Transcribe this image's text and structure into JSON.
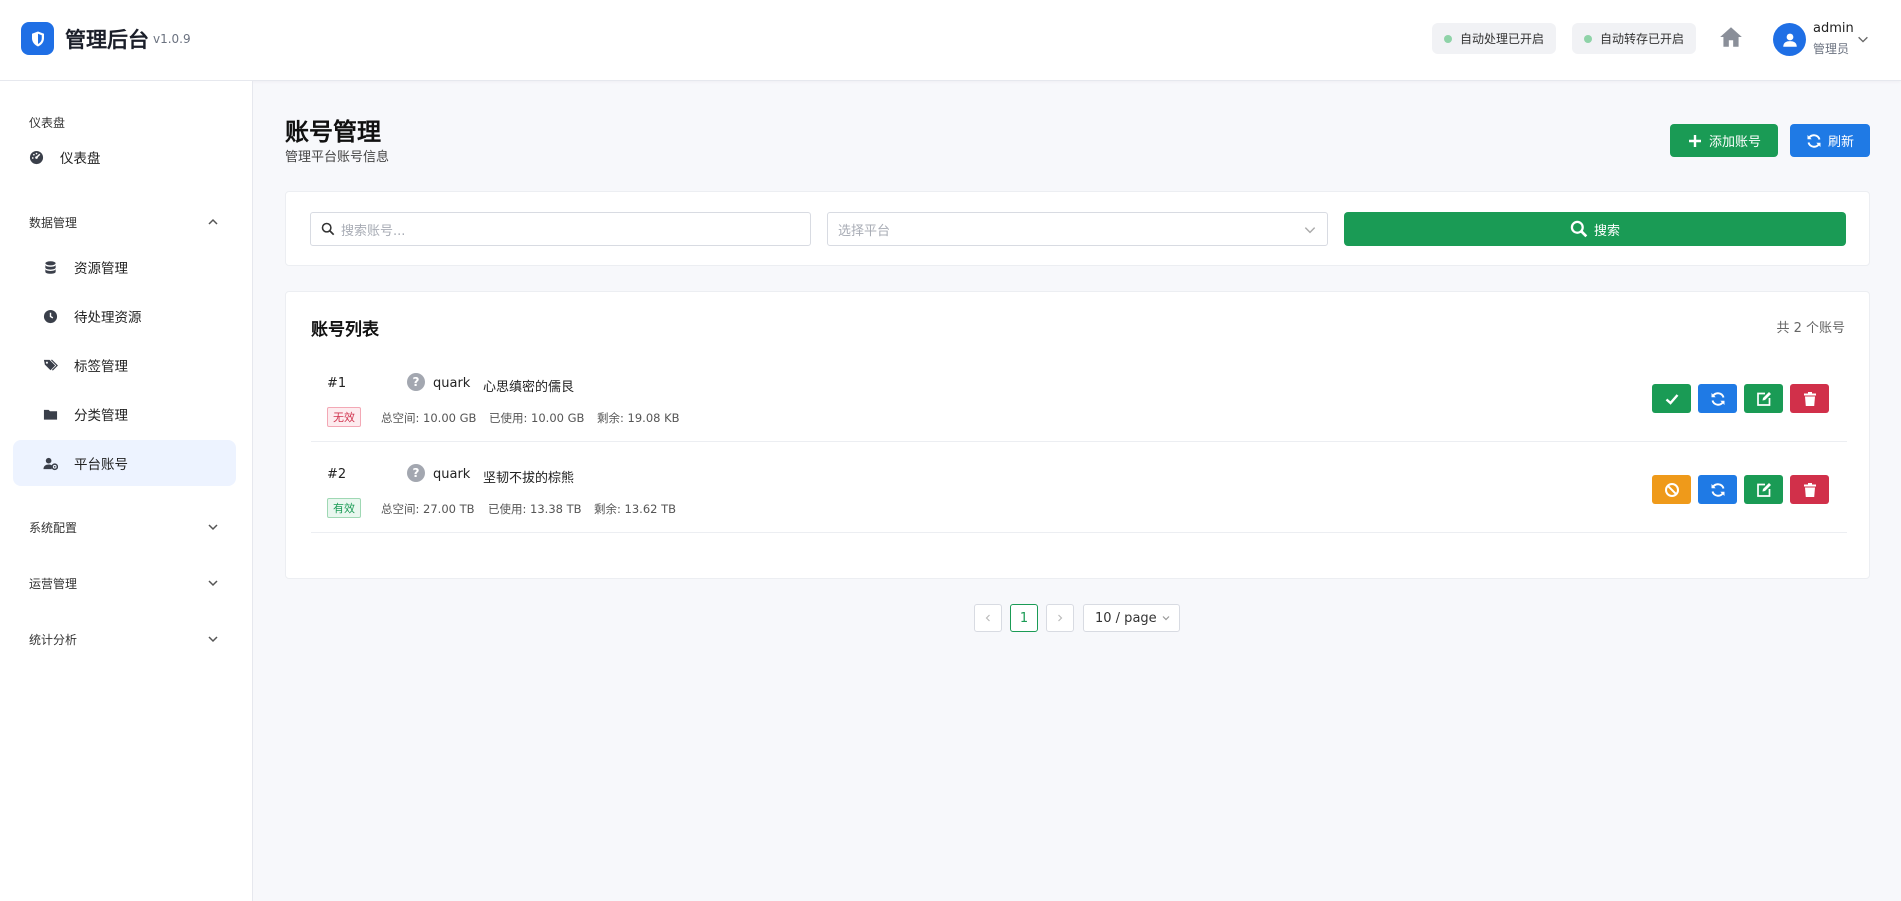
{
  "app": {
    "title": "管理后台",
    "version": "v1.0.9"
  },
  "header": {
    "status_auto_process": "自动处理已开启",
    "status_auto_transfer": "自动转存已开启",
    "user_name": "admin",
    "user_role": "管理员"
  },
  "sidebar": {
    "dashboard_group": "仪表盘",
    "dashboard_item": "仪表盘",
    "data_group": "数据管理",
    "data_items": [
      {
        "label": "资源管理"
      },
      {
        "label": "待处理资源"
      },
      {
        "label": "标签管理"
      },
      {
        "label": "分类管理"
      },
      {
        "label": "平台账号"
      }
    ],
    "system_group": "系统配置",
    "ops_group": "运营管理",
    "stats_group": "统计分析"
  },
  "page": {
    "title": "账号管理",
    "subtitle": "管理平台账号信息",
    "add_label": "添加账号",
    "refresh_label": "刷新"
  },
  "search": {
    "account_placeholder": "搜索账号...",
    "platform_placeholder": "选择平台",
    "search_label": "搜索"
  },
  "list": {
    "title": "账号列表",
    "count_text": "共 2 个账号",
    "rows": [
      {
        "index": "#1",
        "icon": "question-icon",
        "platform": "quark",
        "name": "心思缜密的儒艮",
        "status": "无效",
        "total": "总空间: 10.00 GB",
        "used": "已使用: 10.00 GB",
        "remaining": "剩余: 19.08 KB"
      },
      {
        "index": "#2",
        "icon": "question-icon",
        "platform": "quark",
        "name": "坚韧不拔的棕熊",
        "status": "有效",
        "total": "总空间: 27.00 TB",
        "used": "已使用: 13.38 TB",
        "remaining": "剩余: 13.62 TB"
      }
    ]
  },
  "pagination": {
    "current_page": "1",
    "page_size": "10 / page"
  },
  "colors": {
    "primary": "#1f7ae5",
    "success": "#1a9b55",
    "danger": "#d1304a",
    "warning": "#ef9a1a"
  }
}
